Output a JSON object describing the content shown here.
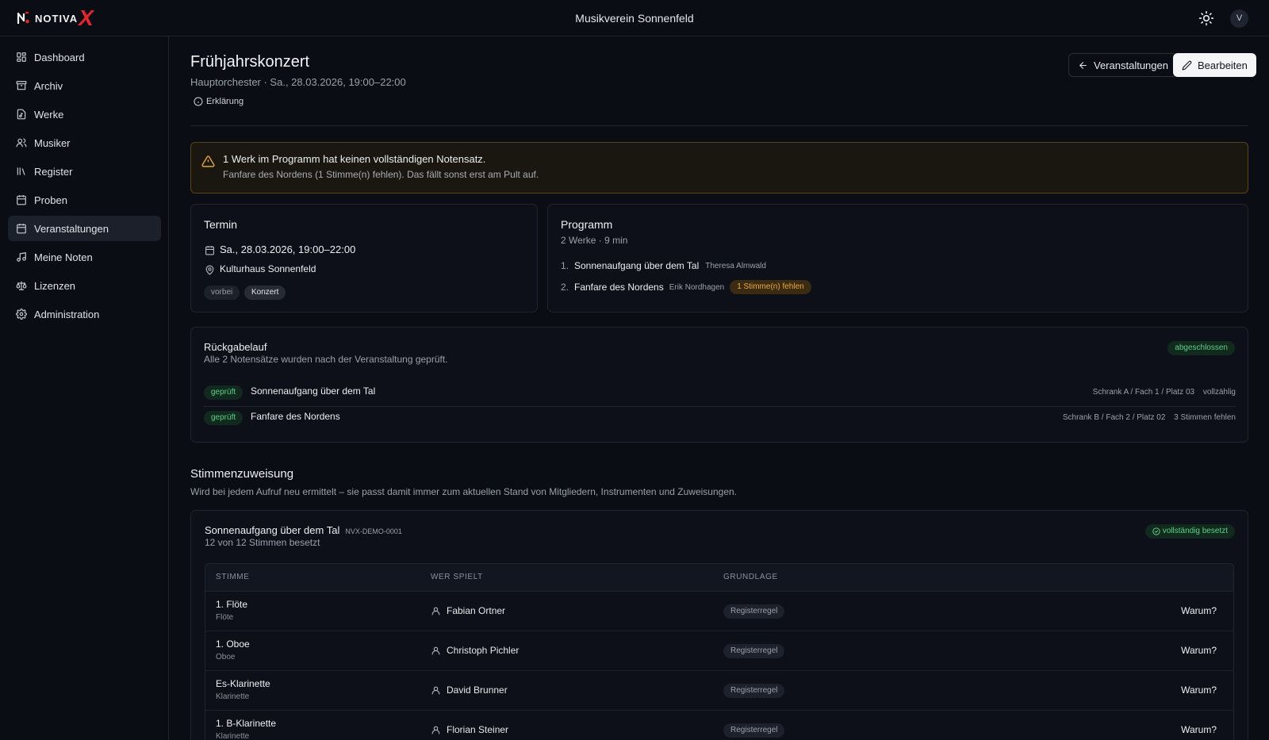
{
  "header": {
    "logo_text": "NOTIVA",
    "logo_accent": "X",
    "org_name": "Musikverein Sonnenfeld",
    "theme_icon": "sun-icon",
    "avatar_initial": "V"
  },
  "sidebar": {
    "items": [
      {
        "label": "Dashboard",
        "icon": "dashboard-icon"
      },
      {
        "label": "Archiv",
        "icon": "archive-icon"
      },
      {
        "label": "Werke",
        "icon": "music-file-icon"
      },
      {
        "label": "Musiker",
        "icon": "users-icon"
      },
      {
        "label": "Register",
        "icon": "library-icon"
      },
      {
        "label": "Proben",
        "icon": "calendar-icon"
      },
      {
        "label": "Veranstaltungen",
        "icon": "calendar-event-icon",
        "active": true
      },
      {
        "label": "Meine Noten",
        "icon": "music-note-icon"
      },
      {
        "label": "Lizenzen",
        "icon": "scale-icon"
      },
      {
        "label": "Administration",
        "icon": "gear-icon"
      }
    ]
  },
  "page": {
    "title": "Frühjahrskonzert",
    "subtitle": "Hauptorchester · Sa., 28.03.2026, 19:00–22:00",
    "explain_label": "Erklärung",
    "back_button": "Veranstaltungen",
    "edit_button": "Bearbeiten"
  },
  "warning": {
    "title": "1 Werk im Programm hat keinen vollständigen Notensatz.",
    "text": "Fanfare des Nordens (1 Stimme(n) fehlen). Das fällt sonst erst am Pult auf."
  },
  "termin": {
    "title": "Termin",
    "date": "Sa., 28.03.2026, 19:00–22:00",
    "location": "Kulturhaus Sonnenfeld",
    "badges": [
      "vorbei",
      "Konzert"
    ]
  },
  "programm": {
    "title": "Programm",
    "summary": "2 Werke · 9 min",
    "items": [
      {
        "num": "1.",
        "title": "Sonnenaufgang über dem Tal",
        "composer": "Theresa Almwald",
        "badge": ""
      },
      {
        "num": "2.",
        "title": "Fanfare des Nordens",
        "composer": "Erik Nordhagen",
        "badge": "1 Stimme(n) fehlen"
      }
    ]
  },
  "rueckgabe": {
    "title": "Rückgabelauf",
    "subtitle": "Alle 2 Notensätze wurden nach der Veranstaltung geprüft.",
    "status": "abgeschlossen",
    "rows": [
      {
        "badge": "geprüft",
        "title": "Sonnenaufgang über dem Tal",
        "location": "Schrank A / Fach 1 / Platz 03",
        "state": "vollzählig"
      },
      {
        "badge": "geprüft",
        "title": "Fanfare des Nordens",
        "location": "Schrank B / Fach 2 / Platz 02",
        "state": "3 Stimmen fehlen"
      }
    ]
  },
  "stimmen": {
    "title": "Stimmenzuweisung",
    "subtitle": "Wird bei jedem Aufruf neu ermittelt – sie passt damit immer zum aktuellen Stand von Mitgliedern, Instrumenten und Zuweisungen.",
    "work": {
      "title": "Sonnenaufgang über dem Tal",
      "code": "NVX-DEMO-0001",
      "summary": "12 von 12 Stimmen besetzt",
      "status": "vollständig besetzt"
    },
    "columns": [
      "STIMME",
      "WER SPIELT",
      "GRUNDLAGE"
    ],
    "rows": [
      {
        "part": "1. Flöte",
        "instrument": "Flöte",
        "player": "Fabian Ortner",
        "basis": "Registerregel",
        "why": "Warum?"
      },
      {
        "part": "1. Oboe",
        "instrument": "Oboe",
        "player": "Christoph Pichler",
        "basis": "Registerregel",
        "why": "Warum?"
      },
      {
        "part": "Es-Klarinette",
        "instrument": "Klarinette",
        "player": "David Brunner",
        "basis": "Registerregel",
        "why": "Warum?"
      },
      {
        "part": "1. B-Klarinette",
        "instrument": "Klarinette",
        "player": "Florian Steiner",
        "basis": "Registerregel",
        "why": "Warum?"
      }
    ]
  }
}
